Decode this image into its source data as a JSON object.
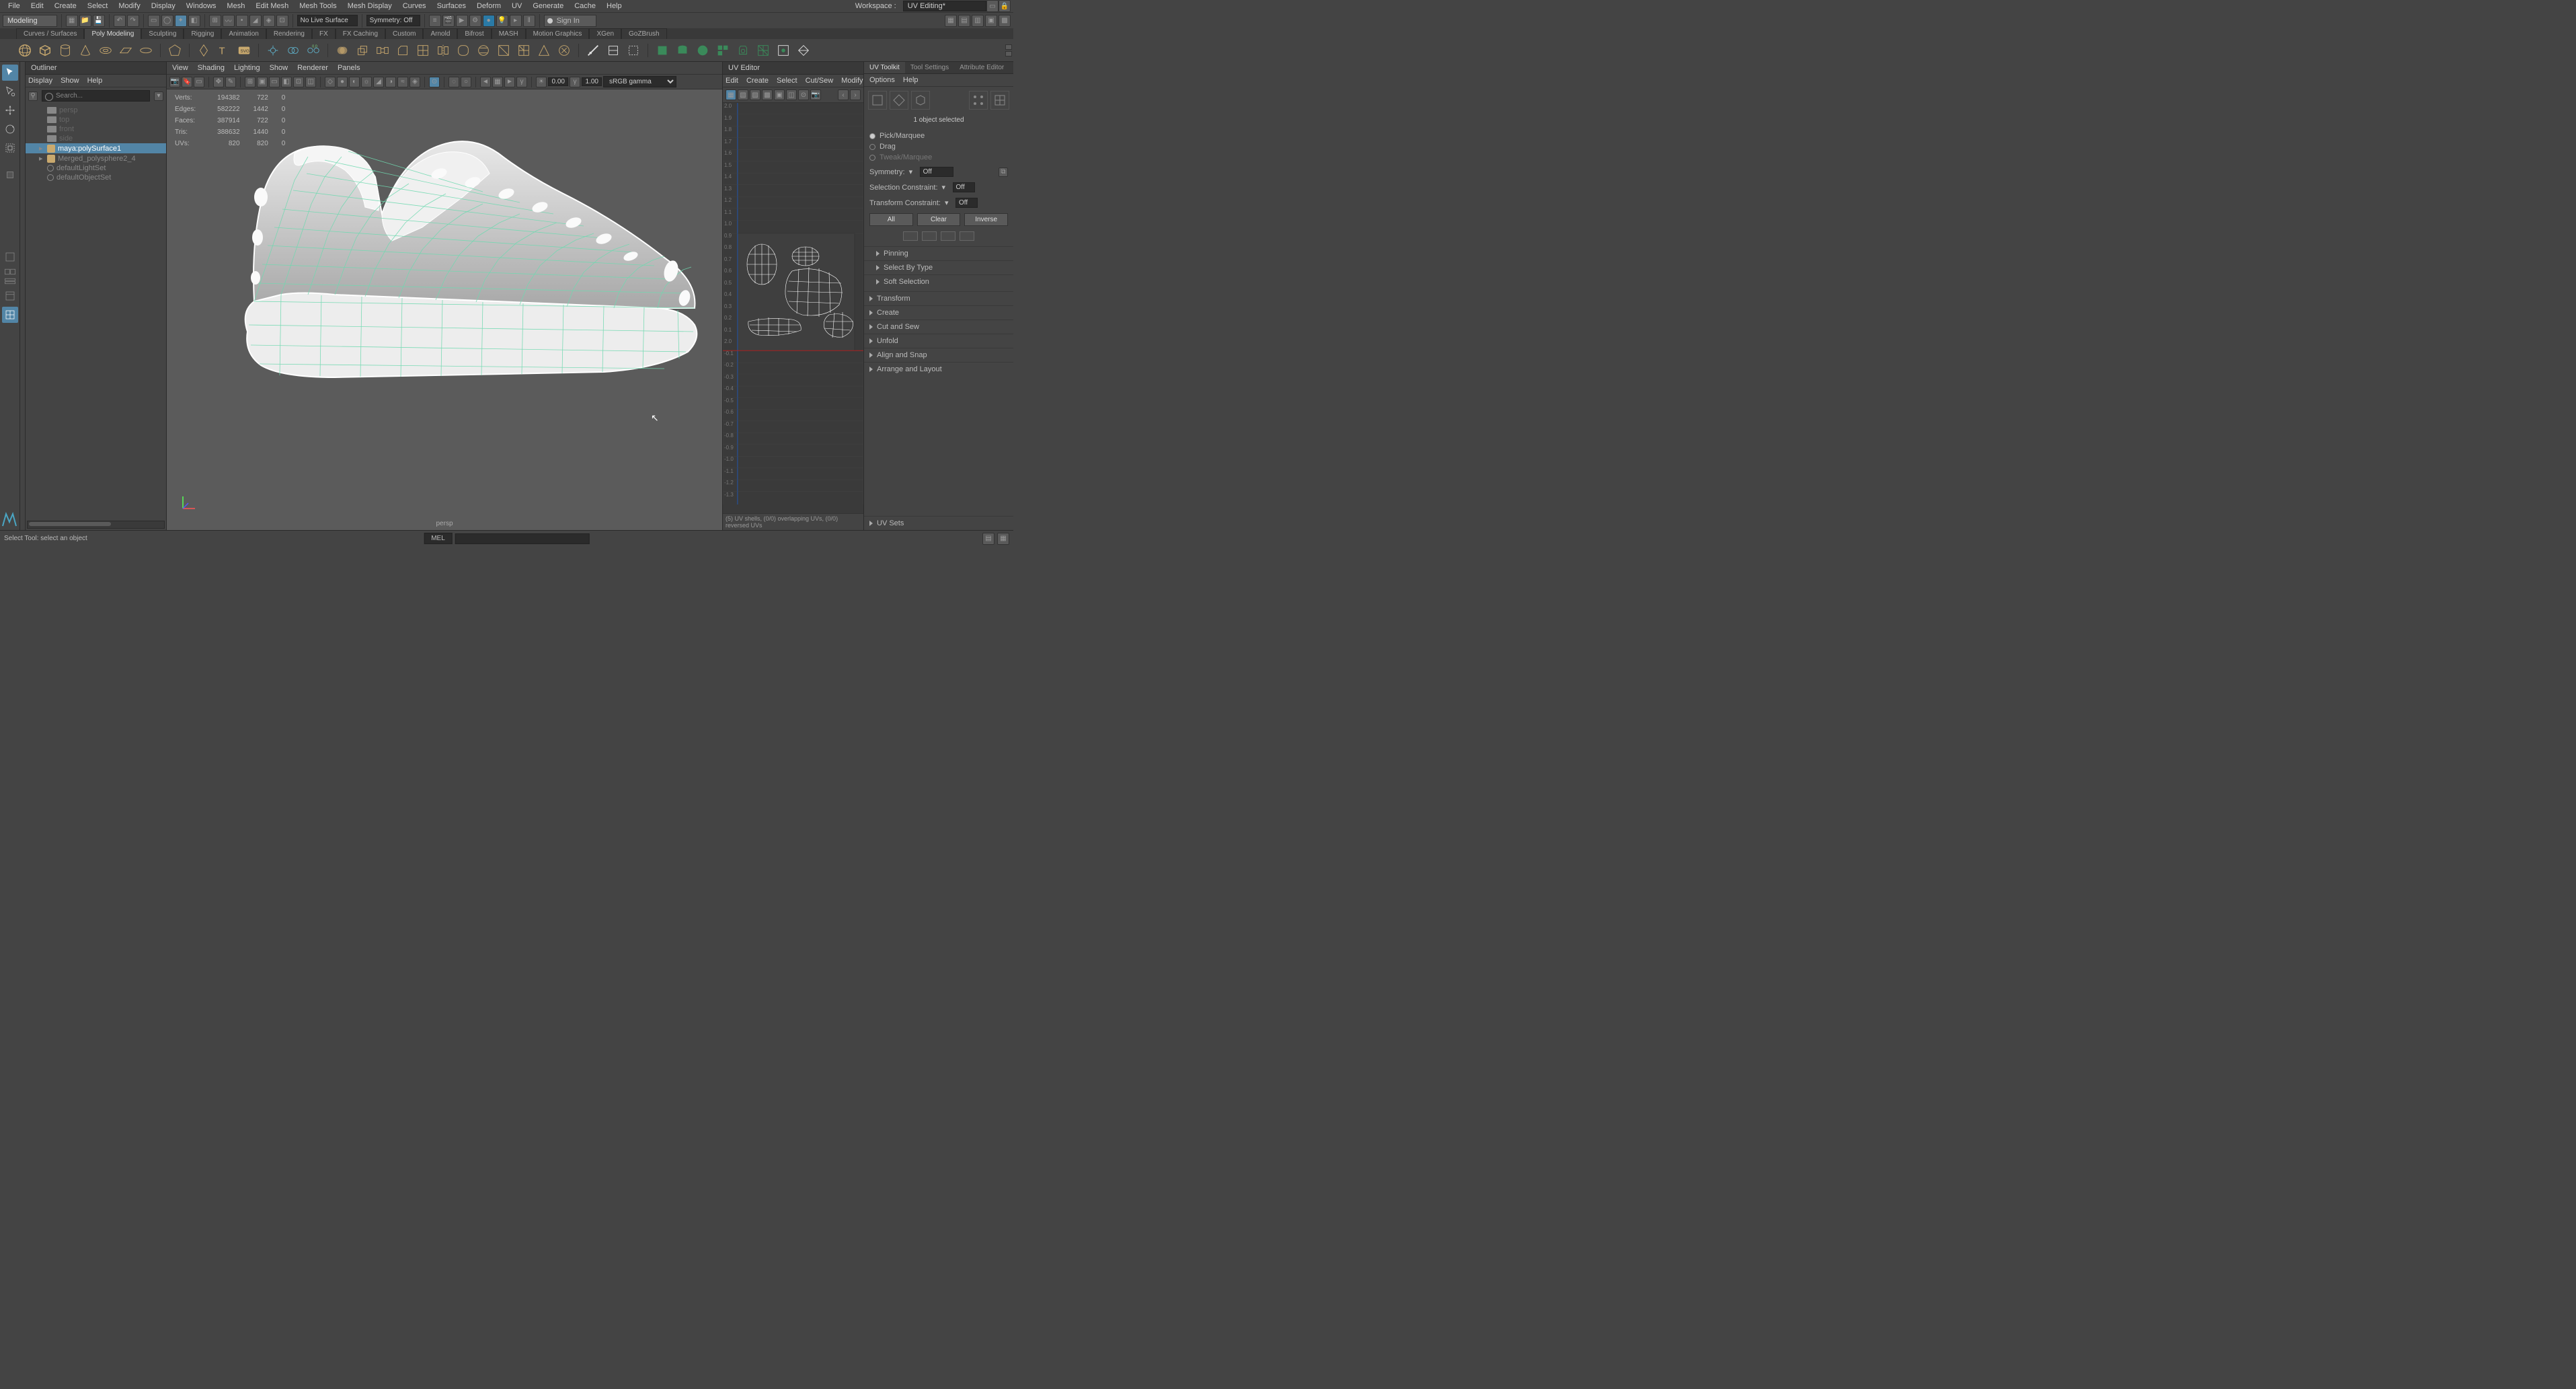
{
  "menubar": {
    "items": [
      "File",
      "Edit",
      "Create",
      "Select",
      "Modify",
      "Display",
      "Windows",
      "Mesh",
      "Edit Mesh",
      "Mesh Tools",
      "Mesh Display",
      "Curves",
      "Surfaces",
      "Deform",
      "UV",
      "Generate",
      "Cache",
      "Help"
    ],
    "workspace_label": "Workspace :",
    "workspace_value": "UV Editing*"
  },
  "statusline": {
    "mode": "Modeling",
    "live_surface": "No Live Surface",
    "symmetry": "Symmetry: Off",
    "signin": "Sign In"
  },
  "shelf_tabs": [
    "Curves / Surfaces",
    "Poly Modeling",
    "Sculpting",
    "Rigging",
    "Animation",
    "Rendering",
    "FX",
    "FX Caching",
    "Custom",
    "Arnold",
    "Bifrost",
    "MASH",
    "Motion Graphics",
    "XGen",
    "GoZBrush"
  ],
  "shelf_active": "Poly Modeling",
  "outliner": {
    "title": "Outliner",
    "menus": [
      "Display",
      "Show",
      "Help"
    ],
    "search_placeholder": "Search...",
    "items": [
      {
        "label": "persp",
        "kind": "cam",
        "dim": true
      },
      {
        "label": "top",
        "kind": "cam",
        "dim": true
      },
      {
        "label": "front",
        "kind": "cam",
        "dim": true
      },
      {
        "label": "side",
        "kind": "cam",
        "dim": true
      },
      {
        "label": "maya:polySurface1",
        "kind": "mesh",
        "sel": true,
        "arrow": true
      },
      {
        "label": "Merged_polysphere2_4",
        "kind": "mesh",
        "arrow": true
      },
      {
        "label": "defaultLightSet",
        "kind": "set"
      },
      {
        "label": "defaultObjectSet",
        "kind": "set"
      }
    ]
  },
  "viewport": {
    "menus": [
      "View",
      "Shading",
      "Lighting",
      "Show",
      "Renderer",
      "Panels"
    ],
    "num1": "0.00",
    "num2": "1.00",
    "colorspace": "sRGB gamma",
    "camera_label": "persp",
    "hud": {
      "rows": [
        {
          "label": "Verts:",
          "a": "194382",
          "b": "722",
          "c": "0"
        },
        {
          "label": "Edges:",
          "a": "582222",
          "b": "1442",
          "c": "0"
        },
        {
          "label": "Faces:",
          "a": "387914",
          "b": "722",
          "c": "0"
        },
        {
          "label": "Tris:",
          "a": "388632",
          "b": "1440",
          "c": "0"
        },
        {
          "label": "UVs:",
          "a": "820",
          "b": "820",
          "c": "0"
        }
      ]
    }
  },
  "uveditor": {
    "title": "UV Editor",
    "menus": [
      "Edit",
      "Create",
      "Select",
      "Cut/Sew",
      "Modify"
    ],
    "ruler": [
      "2.0",
      "1.9",
      "1.8",
      "1.7",
      "1.6",
      "1.5",
      "1.4",
      "1.3",
      "1.2",
      "1.1",
      "1.0",
      "0.9",
      "0.8",
      "0.7",
      "0.6",
      "0.5",
      "0.4",
      "0.3",
      "0.2",
      "0.1",
      "2.0",
      "-0.1",
      "-0.2",
      "-0.3",
      "-0.4",
      "-0.5",
      "-0.6",
      "-0.7",
      "-0.8",
      "-0.9",
      "-1.0",
      "-1.1",
      "-1.2",
      "-1.3"
    ],
    "status": "(5) UV shells, (0/0) overlapping UVs, (0/0) reversed UVs"
  },
  "toolkit": {
    "tabs": [
      "UV Toolkit",
      "Tool Settings",
      "Attribute Editor"
    ],
    "active_tab": "UV Toolkit",
    "menus": [
      "Options",
      "Help"
    ],
    "selected": "1 object selected",
    "radios": [
      {
        "label": "Pick/Marquee",
        "sel": true
      },
      {
        "label": "Drag"
      },
      {
        "label": "Tweak/Marquee",
        "dim": true
      }
    ],
    "symmetry_label": "Symmetry:",
    "symmetry_value": "Off",
    "selc_label": "Selection Constraint:",
    "selc_value": "Off",
    "tc_label": "Transform Constraint:",
    "tc_value": "Off",
    "btn_all": "All",
    "btn_clear": "Clear",
    "btn_inverse": "Inverse",
    "coll1": [
      {
        "label": "Pinning"
      },
      {
        "label": "Select By Type"
      },
      {
        "label": "Soft Selection"
      }
    ],
    "coll2": [
      {
        "label": "Transform"
      },
      {
        "label": "Create"
      },
      {
        "label": "Cut and Sew"
      },
      {
        "label": "Unfold"
      },
      {
        "label": "Align and Snap"
      },
      {
        "label": "Arrange and Layout"
      }
    ],
    "uvsets": "UV Sets"
  },
  "statusbar": {
    "help": "Select Tool: select an object",
    "mel": "MEL"
  }
}
